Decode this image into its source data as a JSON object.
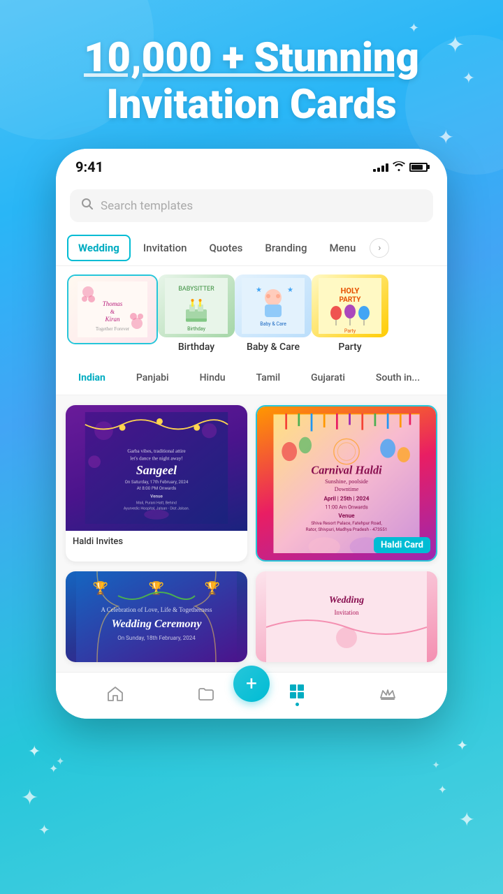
{
  "header": {
    "title_line1": "10,000 + Stunning",
    "title_line2": "Invitation Cards"
  },
  "status_bar": {
    "time": "9:41",
    "signal_bars": [
      4,
      6,
      8,
      10,
      12
    ],
    "battery_label": "battery"
  },
  "search": {
    "placeholder": "Search templates"
  },
  "category_tabs": {
    "items": [
      {
        "id": "wedding",
        "label": "Wedding",
        "active": true
      },
      {
        "id": "invitation",
        "label": "Invitation",
        "active": false
      },
      {
        "id": "quotes",
        "label": "Quotes",
        "active": false
      },
      {
        "id": "branding",
        "label": "Branding",
        "active": false
      },
      {
        "id": "menu",
        "label": "Menu",
        "active": false
      }
    ],
    "more_label": "›"
  },
  "template_cards": [
    {
      "id": "wedding-card",
      "label": "",
      "selected": true,
      "type": "wedding"
    },
    {
      "id": "birthday-card",
      "label": "Birthday",
      "selected": false,
      "type": "birthday"
    },
    {
      "id": "babycare-card",
      "label": "Baby & Care",
      "selected": false,
      "type": "babycare"
    },
    {
      "id": "party-card",
      "label": "Party",
      "selected": false,
      "type": "party"
    }
  ],
  "filter_chips": [
    {
      "id": "indian",
      "label": "Indian",
      "active": true
    },
    {
      "id": "panjabi",
      "label": "Panjabi",
      "active": false
    },
    {
      "id": "hindu",
      "label": "Hindu",
      "active": false
    },
    {
      "id": "tamil",
      "label": "Tamil",
      "active": false
    },
    {
      "id": "gujarati",
      "label": "Gujarati",
      "active": false
    },
    {
      "id": "south-indian",
      "label": "South in...",
      "active": false
    }
  ],
  "invitation_cards": [
    {
      "id": "haldi-invites",
      "caption": "Haldi Invites",
      "badge": null,
      "type": "haldi-sangeet",
      "highlighted": false,
      "card_title": "Sangeel",
      "card_subtitle": "Garba vibes, traditional attire\nlet's dance the night away!"
    },
    {
      "id": "haldi-card",
      "caption": "",
      "badge": "Haldi Card",
      "type": "carnival-haldi",
      "highlighted": true,
      "card_title": "Carnival Haldi",
      "card_subtitle": "Sunshine, poolside Downtime\nApril | 25th | 2024"
    }
  ],
  "second_row_cards": [
    {
      "id": "wedding-ceremony",
      "caption": "",
      "type": "wedding-ceremony",
      "highlighted": false
    },
    {
      "id": "wedding-card-2",
      "caption": "",
      "type": "wedding-pink",
      "highlighted": false
    }
  ],
  "bottom_nav": {
    "items": [
      {
        "id": "home",
        "icon": "⌂",
        "active": false
      },
      {
        "id": "folder",
        "icon": "⌗",
        "active": false
      },
      {
        "id": "templates",
        "icon": "⊞",
        "active": true
      },
      {
        "id": "crown",
        "icon": "♛",
        "active": false
      }
    ],
    "fab_icon": "+"
  }
}
